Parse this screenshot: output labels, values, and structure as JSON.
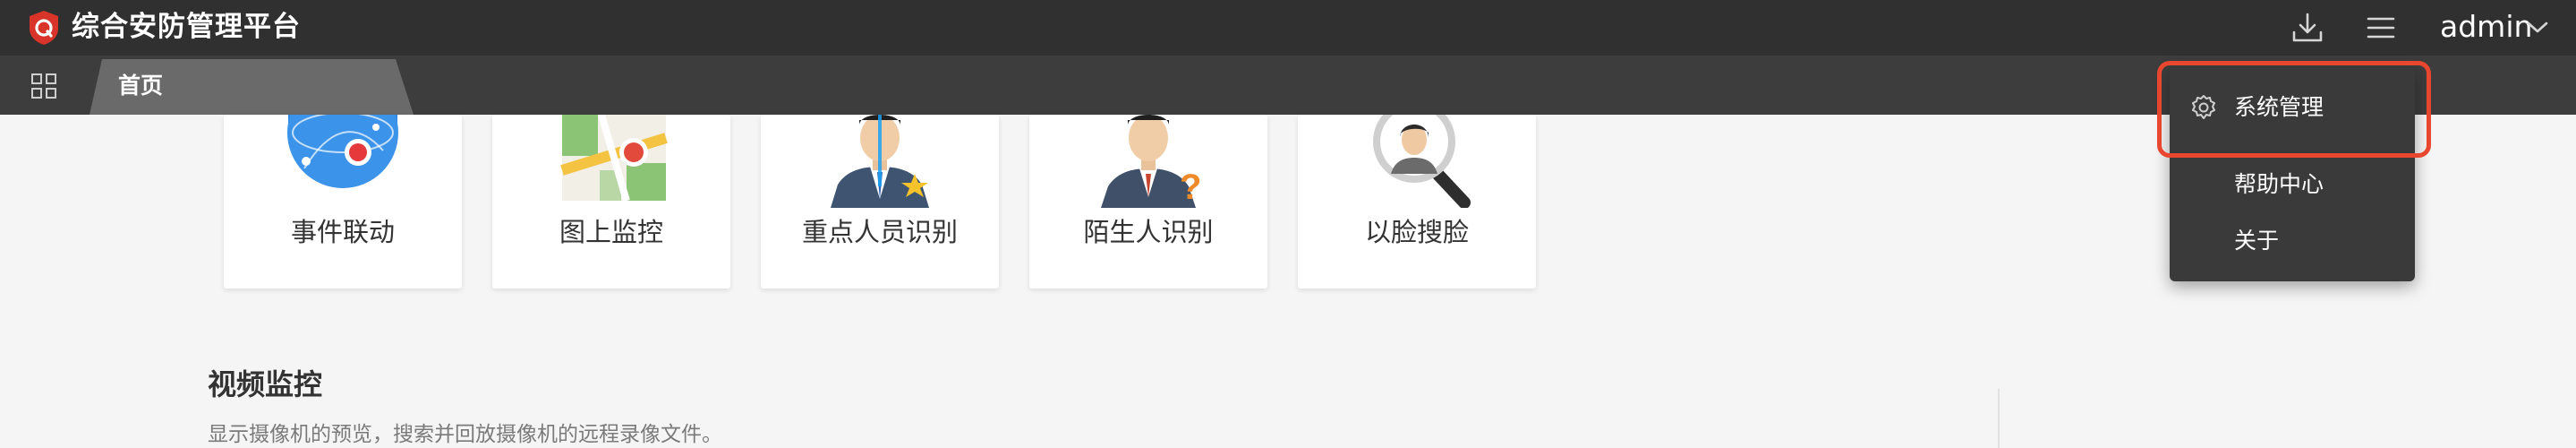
{
  "app": {
    "title": "综合安防管理平台",
    "brand_color": "#d8342a"
  },
  "header": {
    "download_icon": "download-icon",
    "menu_icon": "menu-icon",
    "user_name": "admin"
  },
  "tabs": [
    {
      "label": "首页",
      "active": true
    }
  ],
  "features": [
    {
      "label": "事件联动",
      "icon": "event-linkage-icon"
    },
    {
      "label": "图上监控",
      "icon": "map-monitoring-icon"
    },
    {
      "label": "重点人员识别",
      "icon": "key-person-recognition-icon"
    },
    {
      "label": "陌生人识别",
      "icon": "stranger-recognition-icon"
    },
    {
      "label": "以脸搜脸",
      "icon": "face-search-icon"
    }
  ],
  "section": {
    "title": "视频监控",
    "description": "显示摄像机的预览，搜索并回放摄像机的远程录像文件。"
  },
  "user_menu": {
    "items": [
      {
        "label": "系统管理",
        "icon": "gear-icon",
        "highlighted": true
      },
      {
        "label": "帮助中心"
      },
      {
        "label": "关于"
      }
    ],
    "highlight_color": "#e8462e"
  }
}
